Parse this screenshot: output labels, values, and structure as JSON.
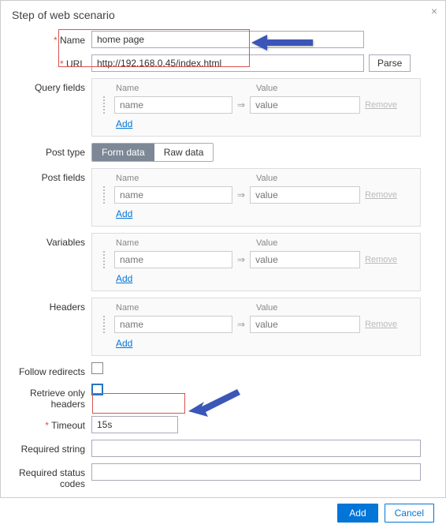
{
  "dialog": {
    "title": "Step of web scenario",
    "close_label": "×"
  },
  "labels": {
    "name": "Name",
    "url": "URL",
    "query_fields": "Query fields",
    "post_type": "Post type",
    "post_fields": "Post fields",
    "variables": "Variables",
    "headers": "Headers",
    "follow_redirects": "Follow redirects",
    "retrieve_only_headers": "Retrieve only headers",
    "timeout": "Timeout",
    "required_string": "Required string",
    "required_status_codes": "Required status codes"
  },
  "values": {
    "name": "home page",
    "url": "http://192.168.0.45/index.html",
    "timeout": "15s",
    "required_string": "",
    "required_status_codes": ""
  },
  "buttons": {
    "parse": "Parse",
    "add": "Add",
    "cancel": "Cancel"
  },
  "post_type": {
    "form_data": "Form data",
    "raw_data": "Raw data",
    "active": "form_data"
  },
  "pair_panel": {
    "head_name": "Name",
    "head_value": "Value",
    "name_placeholder": "name",
    "value_placeholder": "value",
    "arrow": "⇒",
    "remove": "Remove",
    "add": "Add"
  },
  "checkboxes": {
    "follow_redirects": false,
    "retrieve_only_headers": false
  }
}
